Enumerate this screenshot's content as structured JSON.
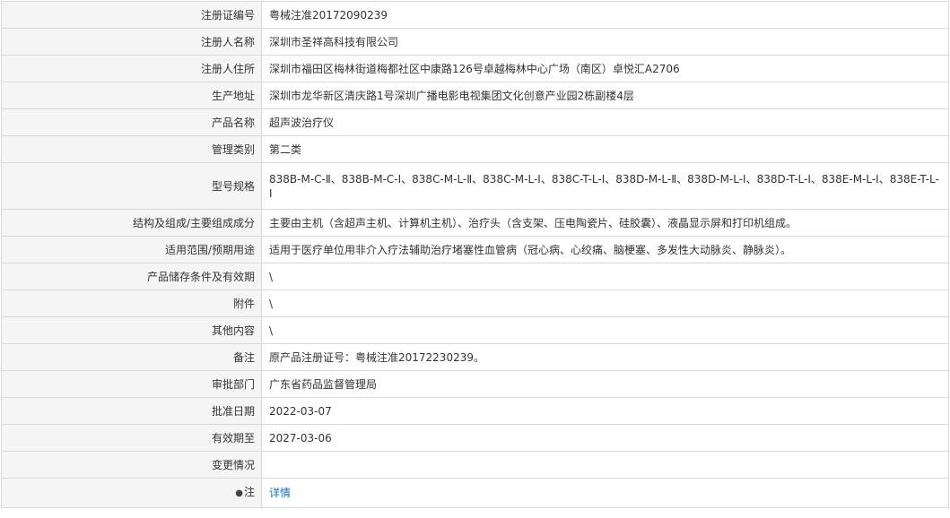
{
  "rows": [
    {
      "label": "注册证编号",
      "value": "粤械注准20172090239"
    },
    {
      "label": "注册人名称",
      "value": "深圳市圣祥高科技有限公司"
    },
    {
      "label": "注册人住所",
      "value": "深圳市福田区梅林街道梅都社区中康路126号卓越梅林中心广场（南区）卓悦汇A2706"
    },
    {
      "label": "生产地址",
      "value": "深圳市龙华新区清庆路1号深圳广播电影电视集团文化创意产业园2栋副楼4层"
    },
    {
      "label": "产品名称",
      "value": "超声波治疗仪"
    },
    {
      "label": "管理类别",
      "value": "第二类"
    },
    {
      "label": "型号规格",
      "value": "838B-M-C-Ⅱ、838B-M-C-Ⅰ、838C-M-L-Ⅱ、838C-M-L-Ⅰ、838C-T-L-Ⅰ、838D-M-L-Ⅱ、838D-M-L-Ⅰ、838D-T-L-Ⅰ、838E-M-L-Ⅰ、838E-T-L-Ⅰ"
    },
    {
      "label": "结构及组成/主要组成成分",
      "value": "主要由主机（含超声主机、计算机主机）、治疗头（含支架、压电陶瓷片、硅胶囊）、液晶显示屏和打印机组成。"
    },
    {
      "label": "适用范围/预期用途",
      "value": "适用于医疗单位用非介入疗法辅助治疗堵塞性血管病（冠心病、心绞痛、脑梗塞、多发性大动脉炎、静脉炎）。"
    },
    {
      "label": "产品储存条件及有效期",
      "value": "\\"
    },
    {
      "label": "附件",
      "value": "\\"
    },
    {
      "label": "其他内容",
      "value": "\\"
    },
    {
      "label": "备注",
      "value": "原产品注册证号：粤械注准20172230239。"
    },
    {
      "label": "审批部门",
      "value": "广东省药品监督管理局"
    },
    {
      "label": "批准日期",
      "value": "2022-03-07"
    },
    {
      "label": "有效期至",
      "value": "2027-03-06"
    },
    {
      "label": "变更情况",
      "value": ""
    }
  ],
  "note": {
    "icon": "bulb-icon",
    "label": "注",
    "link_text": "详情",
    "link_color": "#1a6fc4"
  }
}
